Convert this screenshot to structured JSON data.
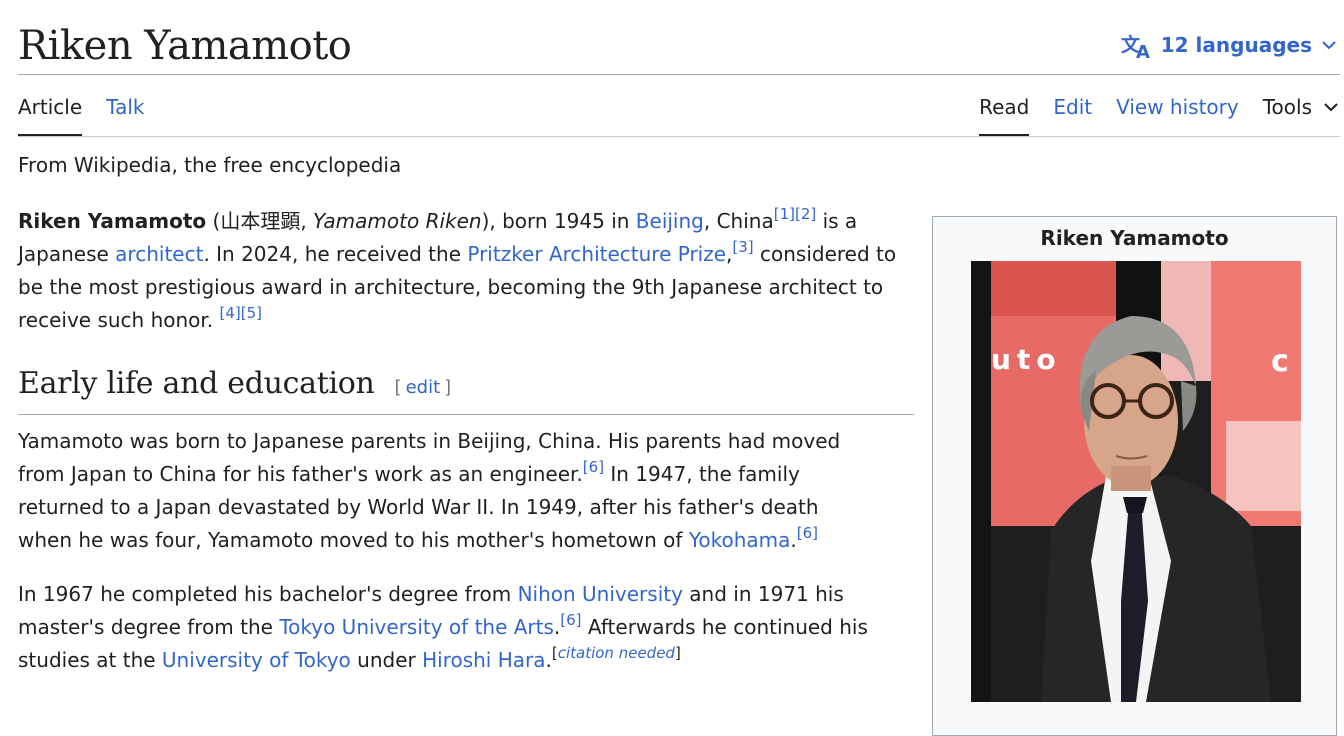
{
  "header": {
    "title": "Riken Yamamoto",
    "languages_label": "12 languages"
  },
  "tabs": {
    "left": [
      "Article",
      "Talk"
    ],
    "right": [
      "Read",
      "Edit",
      "View history",
      "Tools"
    ]
  },
  "tagline": "From Wikipedia, the free encyclopedia",
  "intro": {
    "name": "Riken Yamamoto",
    "open_paren": " (",
    "native_name": "山本理顕",
    "comma": ", ",
    "romaji": "Yamamoto Riken",
    "after_romaji": "), born 1945 in ",
    "beijing": "Beijing",
    "after_beijing": ", China",
    "ref1": "[1]",
    "ref2": "[2]",
    "after_refs": " is a Japanese ",
    "architect": "architect",
    "after_architect": ". In 2024, he received the ",
    "pritzker": "Pritzker Architecture Prize",
    "after_pritzker": ",",
    "ref3": "[3]",
    "after_ref3": " considered to be the most prestigious award in architecture, becoming the 9th Japanese architect to receive such honor. ",
    "ref4": "[4]",
    "ref5": "[5]"
  },
  "section": {
    "heading": "Early life and education",
    "edit_open": "[",
    "edit_label": "edit",
    "edit_close": "]"
  },
  "para1": {
    "t1": "Yamamoto was born to Japanese parents in Beijing, China. His parents had moved from Japan to China for his father's work as an engineer.",
    "ref6a": "[6]",
    "t2": " In 1947, the family returned to a Japan devastated by World War II. In 1949, after his father's death when he was four, Yamamoto moved to his mother's hometown of ",
    "yokohama": "Yokohama",
    "t3": ".",
    "ref6b": "[6]"
  },
  "para2": {
    "t1": "In 1967 he completed his bachelor's degree from ",
    "nihon": "Nihon University",
    "t2": " and in 1971 his master's degree from the ",
    "tokyo_arts": "Tokyo University of the Arts",
    "t3": ".",
    "ref6c": "[6]",
    "t4": " Afterwards he continued his studies at the ",
    "utokyo": "University of Tokyo",
    "t5": " under ",
    "hara": "Hiroshi Hara",
    "t6": ".",
    "cn_open": "[",
    "cn_label": "citation needed",
    "cn_close": "]"
  },
  "infobox": {
    "title": "Riken Yamamoto",
    "photo_text_left": "uto",
    "photo_text_right": "c"
  },
  "colors": {
    "link": "#3366cc",
    "text": "#202122",
    "rule": "#a2a9b1"
  }
}
